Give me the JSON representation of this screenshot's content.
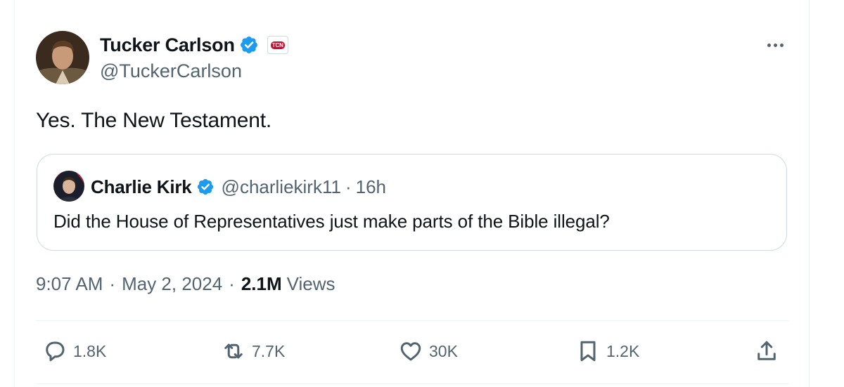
{
  "tweet": {
    "author": {
      "name": "Tucker Carlson",
      "handle": "@TuckerCarlson",
      "affiliate_badge": "TCN"
    },
    "text": "Yes. The New Testament.",
    "quote": {
      "name": "Charlie Kirk",
      "handle": "@charliekirk11",
      "separator": "·",
      "time": "16h",
      "text": "Did the House of Representatives just make parts of the Bible illegal?"
    },
    "meta": {
      "time": "9:07 AM",
      "date": "May 2, 2024",
      "separator": "·",
      "views_count": "2.1M",
      "views_label": "Views"
    },
    "actions": {
      "replies": "1.8K",
      "reposts": "7.7K",
      "likes": "30K",
      "bookmarks": "1.2K"
    }
  },
  "icons": {
    "verified": "verified-badge-icon",
    "more": "more-options-icon",
    "reply": "reply-icon",
    "repost": "repost-icon",
    "like": "heart-icon",
    "bookmark": "bookmark-icon",
    "share": "share-icon"
  },
  "colors": {
    "verified_blue": "#1d9bf0",
    "secondary_text": "#536471",
    "primary_text": "#0f1419",
    "border": "#cfd9de",
    "affiliate_red": "#c8102e"
  }
}
